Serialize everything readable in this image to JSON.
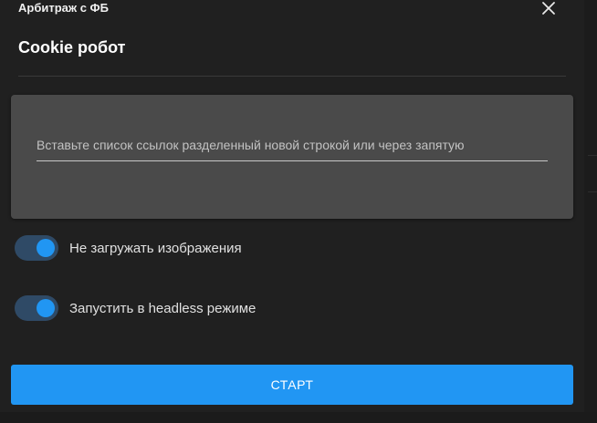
{
  "app": {
    "title": "Арбитраж с ФБ"
  },
  "dialog": {
    "title": "Cookie робот",
    "close_icon": "close-icon",
    "links_input": {
      "value": "",
      "placeholder": "Вставьте список ссылок разделенный новой строкой или через запятую"
    },
    "toggles": [
      {
        "label": "Не загружать изображения",
        "checked": true
      },
      {
        "label": "Запустить в headless режиме",
        "checked": true
      }
    ],
    "start_button": {
      "label": "СТАРТ"
    }
  },
  "colors": {
    "background": "#202020",
    "input_panel": "#4a4a4a",
    "accent": "#2196f3",
    "switch_track": "#2f4a66"
  }
}
